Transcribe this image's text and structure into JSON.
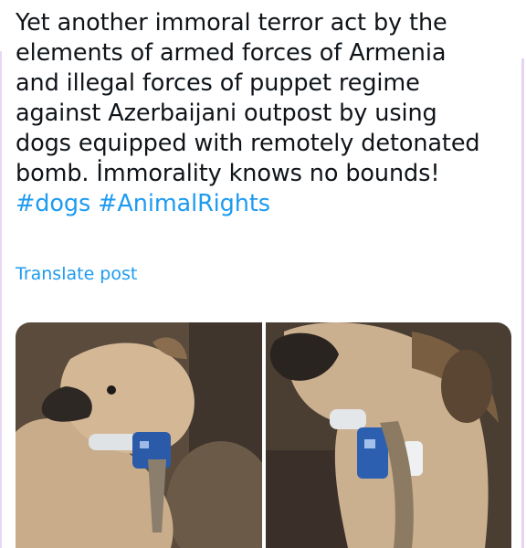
{
  "post": {
    "lines": [
      "Yet another immoral terror act by the",
      "elements of armed forces of Armenia",
      "and illegal forces of puppet regime",
      "against Azerbaijani outpost by using",
      "dogs equipped with remotely detonated",
      "bomb. İmmorality knows no bounds!"
    ],
    "hashtags": [
      "#dogs",
      "#AnimalRights"
    ],
    "translate_label": "Translate post"
  },
  "media": [
    {
      "depicts": "dog-with-bomb-collar-photo"
    },
    {
      "depicts": "dog-with-bomb-collar-closeup-photo"
    }
  ],
  "colors": {
    "text": "#0f1419",
    "link": "#1d9bf0",
    "border_accent": "#e9d6f4",
    "background": "#ffffff"
  }
}
